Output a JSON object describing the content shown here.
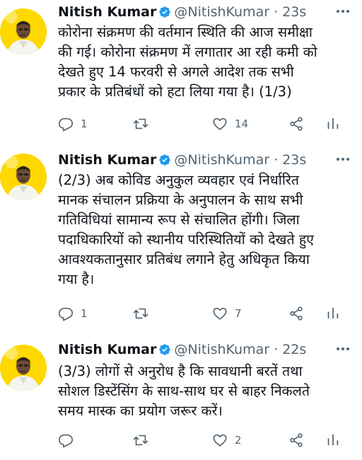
{
  "tweets": [
    {
      "name": "Nitish Kumar",
      "handle": "@NitishKumar",
      "separator": "·",
      "time": "23s",
      "lines": [
        "कोरोना संक्रमण की वर्तमान स्थिति की आज समीक्षा",
        "की गई। कोरोना संक्रमण में लगातार आ रही कमी को",
        "देखते हुए 14 फरवरी से अगले आदेश तक सभी",
        "प्रकार के प्रतिबंधों को हटा लिया गया है। (1/3)"
      ],
      "reply_count": "1",
      "retweet_count": "",
      "like_count": "14"
    },
    {
      "name": "Nitish Kumar",
      "handle": "@NitishKumar",
      "separator": "·",
      "time": "23s",
      "lines": [
        "(2/3) अब कोविड अनुकुल व्यवहार एवं निर्धारित",
        "मानक संचालन प्रक्रिया के अनुपालन के साथ सभी",
        "गतिविधियां सामान्य रूप से संचालित होंगी। जिला",
        "पदाधिकारियों को स्थानीय परिस्थितियों को देखते हुए",
        "आवश्यकतानुसार प्रतिबंध लगाने हेतु अधिकृत किया",
        "गया है।"
      ],
      "reply_count": "1",
      "retweet_count": "",
      "like_count": "7"
    },
    {
      "name": "Nitish Kumar",
      "handle": "@NitishKumar",
      "separator": "·",
      "time": "22s",
      "lines": [
        "(3/3) लोगों से अनुरोध है कि सावधानी बरतें तथा",
        "सोशल डिस्टेंसिंग के साथ-साथ घर से बाहर निकलते",
        "समय मास्क का प्रयोग जरूर करें।"
      ],
      "reply_count": "",
      "retweet_count": "",
      "like_count": "2"
    }
  ],
  "icons": {
    "verified": "verified-badge-icon",
    "reply": "reply-icon",
    "retweet": "retweet-icon",
    "like": "heart-icon",
    "share": "share-icon",
    "analytics": "analytics-icon",
    "more": "more-icon"
  },
  "colors": {
    "avatar_bg": "#ffd800",
    "verified": "#1d9bf0",
    "secondary_text": "#536471",
    "primary_text": "#0f1419"
  }
}
